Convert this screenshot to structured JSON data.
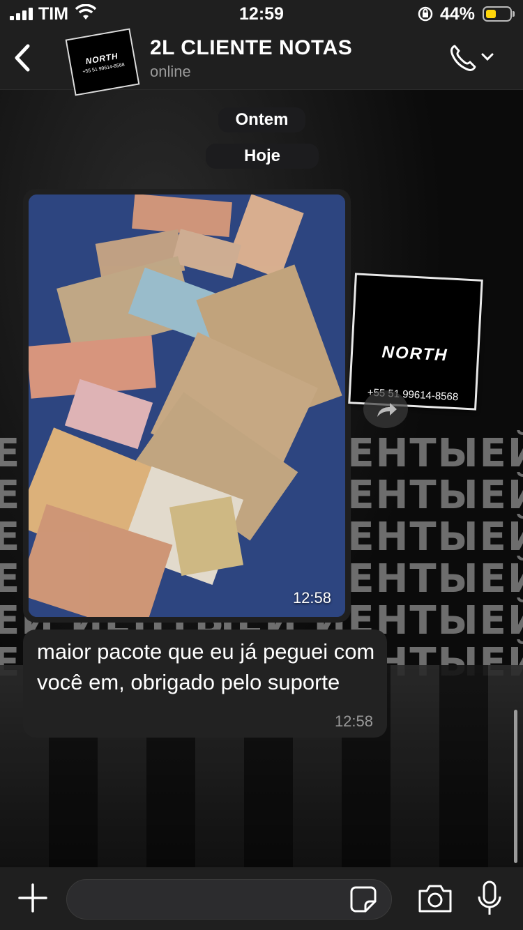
{
  "status_bar": {
    "carrier": "TIM",
    "time": "12:59",
    "battery_percent": "44%",
    "battery_level": 0.44,
    "battery_color": "#ffd60a"
  },
  "header": {
    "contact_name": "2L CLIENTE NOTAS",
    "contact_status": "online",
    "avatar_brand": "NORTH",
    "avatar_phone": "+55 51 99614-8568"
  },
  "chat": {
    "date_pills": [
      "Ontem",
      "Hoje"
    ],
    "photo_message": {
      "time": "12:58"
    },
    "sticker": {
      "brand": "NORTH",
      "phone": "+55 51 99614-8568"
    },
    "text_message": {
      "text": "maior pacote que eu já peguei com você em, obrigado pelo suporte",
      "time": "12:58"
    },
    "wallpaper_text": "ЙЕНТЫЕЙ"
  },
  "input_bar": {
    "placeholder": ""
  },
  "icons": [
    "back-icon",
    "phone-icon",
    "chevron-down-icon",
    "forward-icon",
    "plus-icon",
    "sticker-icon",
    "camera-icon",
    "mic-icon",
    "wifi-icon",
    "rotation-lock-icon"
  ]
}
